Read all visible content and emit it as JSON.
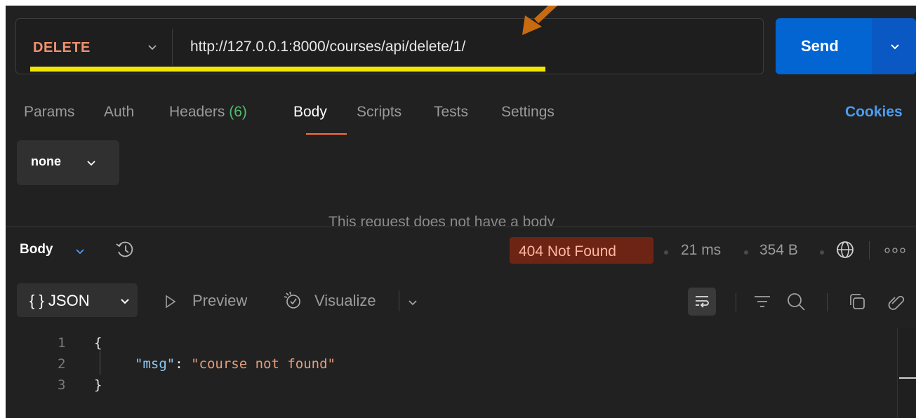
{
  "request": {
    "method": "DELETE",
    "url": "http://127.0.0.1:8000/courses/api/delete/1/",
    "send_label": "Send"
  },
  "tabs": [
    {
      "label": "Params"
    },
    {
      "label": "Auth"
    },
    {
      "label": "Headers",
      "count": "(6)"
    },
    {
      "label": "Body"
    },
    {
      "label": "Scripts"
    },
    {
      "label": "Tests"
    },
    {
      "label": "Settings"
    }
  ],
  "active_tab": "Body",
  "cookies_label": "Cookies",
  "body_type": "none",
  "no_body_message": "This request does not have a body",
  "response": {
    "section_label": "Body",
    "status": "404 Not Found",
    "time": "21 ms",
    "size": "354 B",
    "format": "{ } JSON",
    "preview_label": "Preview",
    "visualize_label": "Visualize",
    "lines": [
      {
        "number": "1",
        "text": "{"
      },
      {
        "number": "2",
        "key": "\"msg\"",
        "colon": ": ",
        "value": "\"course not found\""
      },
      {
        "number": "3",
        "text": "}"
      }
    ]
  },
  "colors": {
    "method": "#f0906f",
    "send": "#0265d2",
    "status_bg": "#6e2415",
    "highlight": "#f3e600",
    "arrow": "#c86a10"
  },
  "icons": [
    "chevron-down-icon",
    "history-icon",
    "globe-icon",
    "more-icon",
    "preview-icon",
    "visualize-icon",
    "wrap-icon",
    "filter-icon",
    "search-icon",
    "copy-icon",
    "link-icon",
    "arrow-annotation"
  ]
}
